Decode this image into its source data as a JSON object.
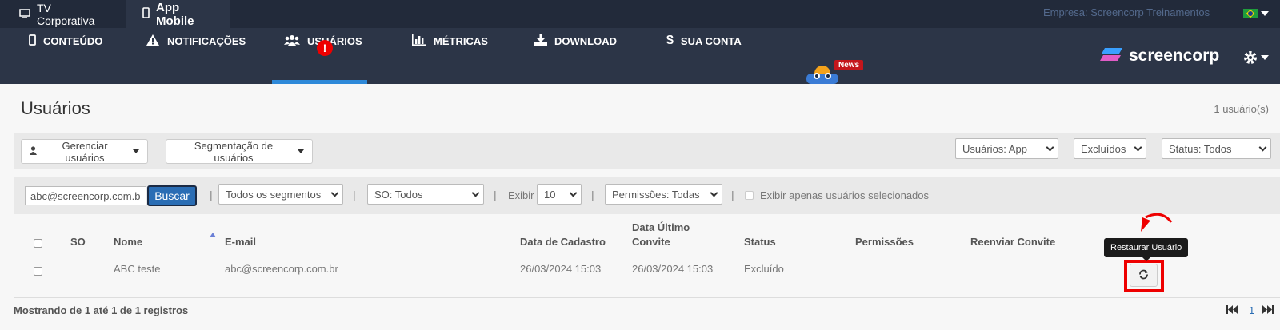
{
  "topbar": {
    "tabs": [
      {
        "label": "TV Corporativa",
        "icon": "monitor-icon"
      },
      {
        "label": "App Mobile",
        "icon": "mobile-icon"
      }
    ],
    "company": "Empresa: Screencorp Treinamentos",
    "flag": "brazil-flag-icon"
  },
  "nav": {
    "items": [
      {
        "label": "CONTEÚDO",
        "icon": "mobile-icon"
      },
      {
        "label": "NOTIFICAÇÕES",
        "icon": "warning-icon"
      },
      {
        "label": "USUÁRIOS",
        "icon": "users-icon"
      },
      {
        "label": "MÉTRICAS",
        "icon": "bar-chart-icon"
      },
      {
        "label": "DOWNLOAD",
        "icon": "download-icon"
      },
      {
        "label": "SUA CONTA",
        "icon": "dollar-icon"
      }
    ],
    "alert_badge": "!",
    "news_badge": "News",
    "logo": "screencorp",
    "accent": "#2e89d9"
  },
  "main": {
    "title": "Usuários",
    "count": "1 usuário(s)",
    "manage_button": "Gerenciar usuários",
    "segmentation_button": "Segmentação de usuários",
    "filters_top": {
      "users_type": "Usuários: App",
      "excluded": "Excluídos",
      "status": "Status: Todos"
    },
    "search": {
      "value": "abc@screencorp.com.br",
      "button": "Buscar"
    },
    "segments_select": "Todos os segmentos",
    "os_select": "SO: Todos",
    "show_label": "Exibir",
    "show_select": "10",
    "permissions_select": "Permissões: Todas",
    "only_selected_label": "Exibir apenas usuários selecionados",
    "table": {
      "headers": [
        "SO",
        "Nome",
        "E-mail",
        "Data de Cadastro",
        "Data Último",
        "Convite",
        "Status",
        "Permissões",
        "Reenviar Convite"
      ],
      "rows": [
        {
          "so": "",
          "nome": "ABC teste",
          "email": "abc@screencorp.com.br",
          "cadastro": "26/03/2024 15:03",
          "convite": "26/03/2024 15:03",
          "status": "Excluído",
          "permissoes": "",
          "reenviar": ""
        }
      ]
    },
    "restore_tooltip": "Restaurar Usuário",
    "footer": "Mostrando de 1 até 1 de 1 registros",
    "pagination": {
      "current": "1"
    }
  }
}
